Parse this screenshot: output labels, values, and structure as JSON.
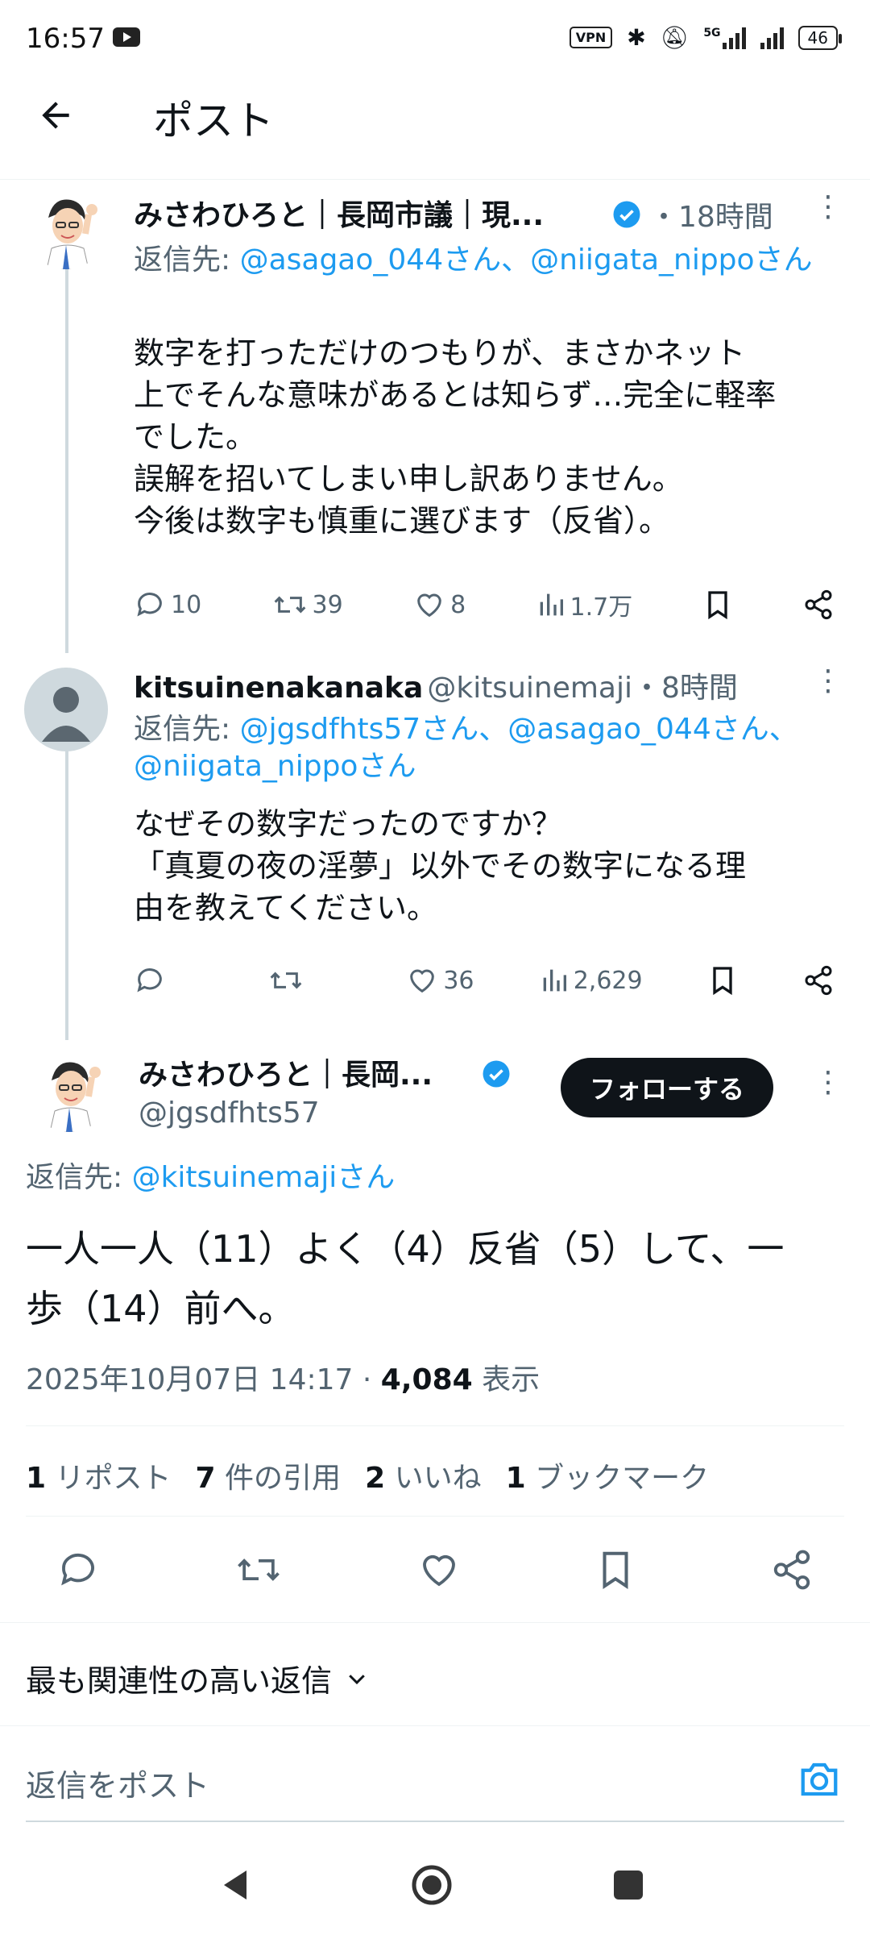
{
  "status_bar": {
    "time": "16:57",
    "vpn": "VPN",
    "network": "5G",
    "battery": "46"
  },
  "header": {
    "title": "ポスト"
  },
  "tweet1": {
    "name": "みさわひろと｜長岡市議｜現...",
    "time": "・18時間",
    "reply_prefix": "返信先: ",
    "reply_targets": "@asagao_044さん、@niigata_nippoさん",
    "body": [
      "数字を打っただけのつもりが、まさかネット",
      "上でそんな意味があるとは知らず…完全に軽率",
      "でした。",
      "誤解を招いてしまい申し訳ありません。",
      "今後は数字も慎重に選びます（反省）。"
    ],
    "replies": "10",
    "reposts": "39",
    "likes": "8",
    "views": "1.7万"
  },
  "tweet2": {
    "name": "kitsuinenakanaka",
    "handle": "@kitsuinemaji",
    "time": "・8時間",
    "reply_prefix": "返信先: ",
    "reply_targets": "@jgsdfhts57さん、@asagao_044さん、@niigata_nippoさん",
    "body": [
      "なぜその数字だったのですか？",
      "「真夏の夜の淫夢」以外でその数字になる理",
      "由を教えてください。"
    ],
    "replies": "",
    "reposts": "",
    "likes": "36",
    "views": "2,629"
  },
  "main_tweet": {
    "name": "みさわひろと｜長岡...",
    "handle": "@jgsdfhts57",
    "follow_label": "フォローする",
    "reply_prefix": "返信先: ",
    "reply_targets": "@kitsuinemajiさん",
    "body": [
      "一人一人（11）よく（4）反省（5）して、一",
      "歩（14）前へ。"
    ],
    "timestamp": "2025年10月07日 14:17",
    "views_count": "4,084",
    "views_label": "表示",
    "stats": [
      {
        "count": "1",
        "label": "リポスト"
      },
      {
        "count": "7",
        "label": "件の引用"
      },
      {
        "count": "2",
        "label": "いいね"
      },
      {
        "count": "1",
        "label": "ブックマーク"
      }
    ]
  },
  "sort": {
    "label": "最も関連性の高い返信"
  },
  "reply_box": {
    "placeholder": "返信をポスト"
  },
  "colors": {
    "accent": "#1d9bf0",
    "text": "#0f1419",
    "muted": "#536471",
    "verified": "#1d9bf0"
  }
}
